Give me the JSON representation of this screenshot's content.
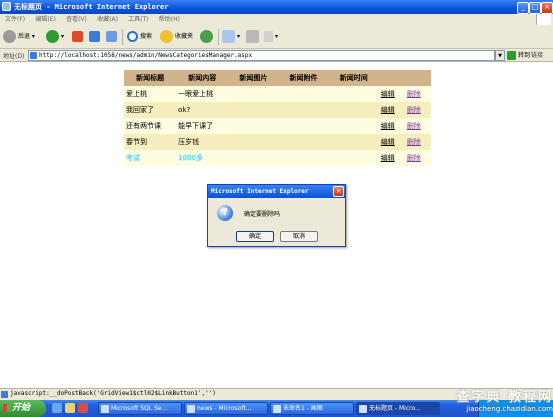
{
  "window": {
    "title": "无标题页 - Microsoft Internet Explorer"
  },
  "menu": [
    "文件(F)",
    "编辑(E)",
    "查看(V)",
    "收藏(A)",
    "工具(T)",
    "帮助(H)"
  ],
  "toolbar": {
    "back": "后退",
    "search": "搜索",
    "favorites": "收藏夹"
  },
  "address": {
    "label": "地址(D)",
    "url": "http://localhost:1058/news/admin/NewsCategoriesManager.aspx",
    "go": "转到",
    "links": "链接"
  },
  "table": {
    "headers": [
      "新闻标题",
      "新闻内容",
      "新闻图片",
      "新闻附件",
      "新闻时间",
      "",
      ""
    ],
    "rows": [
      {
        "title": "爱上桃",
        "content": "一眼爱上桃",
        "edit": "编辑",
        "delete": "删除"
      },
      {
        "title": "我回家了",
        "content": "ok?",
        "edit": "编辑",
        "delete": "删除"
      },
      {
        "title": "还有两节课",
        "content": "能早下课了",
        "edit": "编辑",
        "delete": "删除"
      },
      {
        "title": "春节到",
        "content": "压岁钱",
        "edit": "编辑",
        "delete": "删除"
      },
      {
        "title": "考试",
        "content": "1000多",
        "edit": "编辑",
        "delete": "删除"
      }
    ]
  },
  "dialog": {
    "title": "Microsoft Internet Explorer",
    "message": "确定要删除吗",
    "ok": "确定",
    "cancel": "取消"
  },
  "status": {
    "text": "javascript:__doPostBack('GridView1$ctl02$LinkButton1','')"
  },
  "taskbar": {
    "start": "开始",
    "tasks": [
      "Microsoft SQL Se...",
      "news - Microsoft...",
      "未命名1 - 画图",
      "无标题页 - Micro..."
    ]
  },
  "watermark": {
    "line1": "查字典 教程网",
    "line2": "jiaocheng.chazidian.com"
  },
  "colors": {
    "header_bg": "#d2b48c",
    "row_odd": "#fffde0",
    "row_even": "#f5eebe",
    "xp_blue": "#0a52d8"
  }
}
